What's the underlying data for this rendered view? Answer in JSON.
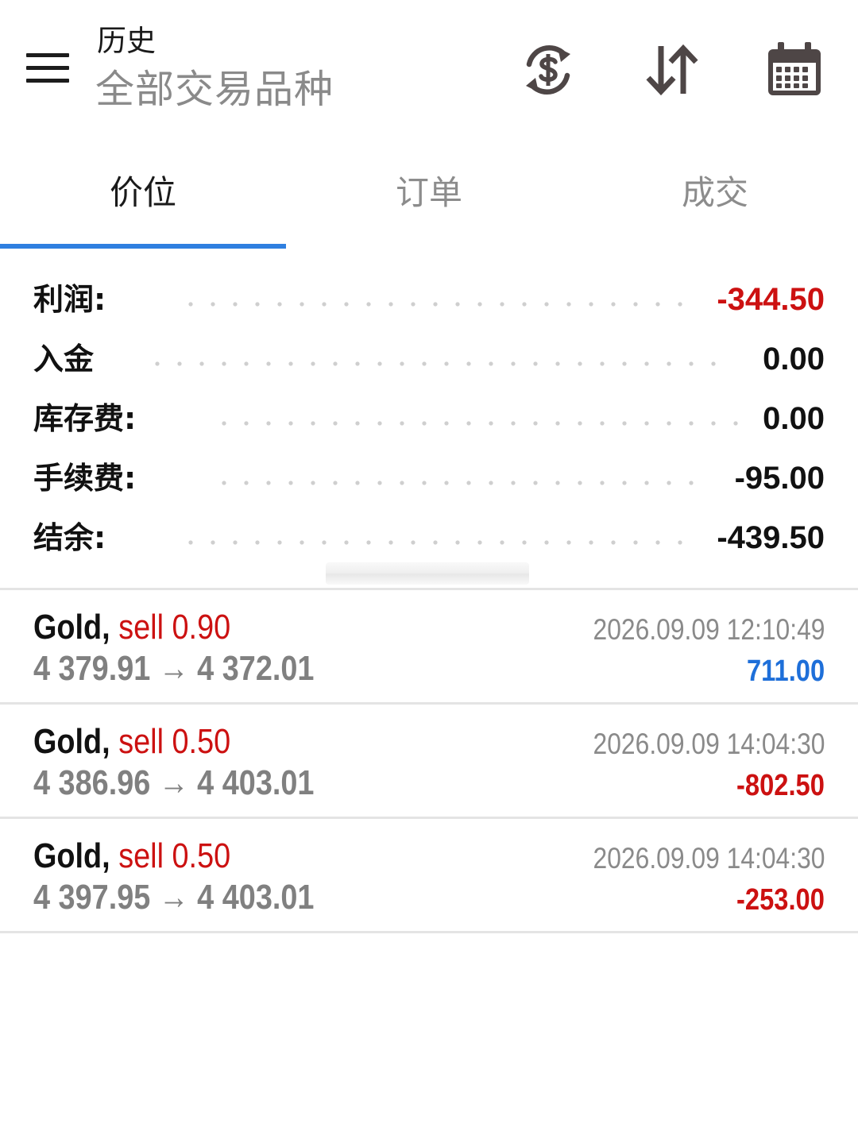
{
  "header": {
    "title": "历史",
    "subtitle": "全部交易品种",
    "icons": [
      "menu-icon",
      "currency-exchange-icon",
      "sort-icon",
      "calendar-icon"
    ]
  },
  "tabs": [
    {
      "label": "价位",
      "active": true
    },
    {
      "label": "订单",
      "active": false
    },
    {
      "label": "成交",
      "active": false
    }
  ],
  "summary": {
    "profit": {
      "label": "利润:",
      "value": "-344.50"
    },
    "deposit": {
      "label": "入金",
      "value": "0.00"
    },
    "swap": {
      "label": "库存费:",
      "value": "0.00"
    },
    "commission": {
      "label": "手续费:",
      "value": "-95.00"
    },
    "balance": {
      "label": "结余:",
      "value": "-439.50"
    }
  },
  "deals": [
    {
      "symbol": "Gold,",
      "type": "sell 0.90",
      "open_price": "4 379.91",
      "close_price": "4 372.01",
      "time": "2026.09.09 12:10:49",
      "profit": "711.00"
    },
    {
      "symbol": "Gold,",
      "type": "sell 0.50",
      "open_price": "4 386.96",
      "close_price": "4 403.01",
      "time": "2026.09.09 14:04:30",
      "profit": "-802.50"
    },
    {
      "symbol": "Gold,",
      "type": "sell 0.50",
      "open_price": "4 397.95",
      "close_price": "4 403.01",
      "time": "2026.09.09 14:04:30",
      "profit": "-253.00"
    }
  ],
  "arrow_glyph": "→",
  "colors": {
    "accent": "#2f7fe0",
    "loss": "#cc1111",
    "gain": "#1e6fd9",
    "muted": "#8a8a8a"
  }
}
